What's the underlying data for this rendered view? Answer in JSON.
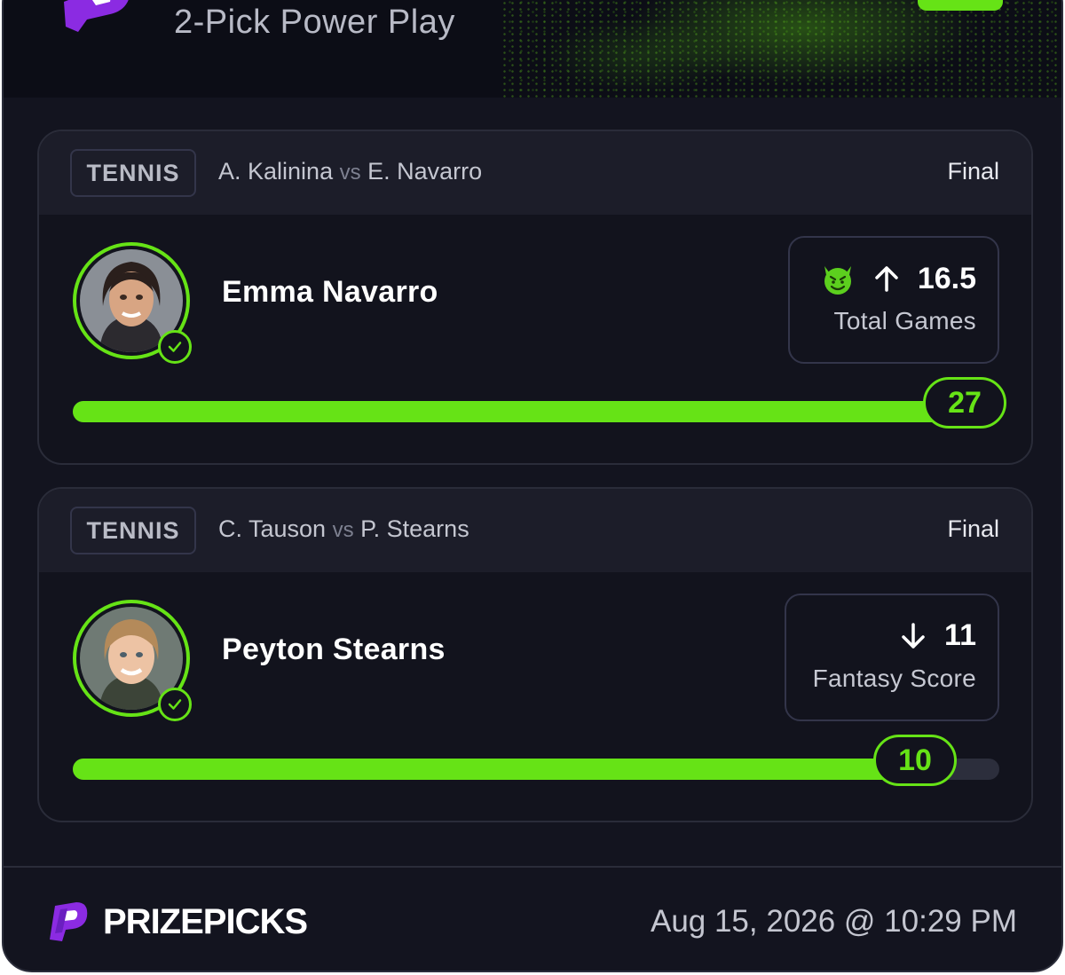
{
  "header": {
    "title": "2-Pick Power Play"
  },
  "picks": [
    {
      "sport": "TENNIS",
      "team_a": "A. Kalinina",
      "vs": "vs",
      "team_b": "E. Navarro",
      "status": "Final",
      "player": "Emma Navarro",
      "direction": "up",
      "line": "16.5",
      "stat": "Total Games",
      "result": "27",
      "progress_percent": 100,
      "icon": "demon-emoji-icon"
    },
    {
      "sport": "TENNIS",
      "team_a": "C. Tauson",
      "vs": "vs",
      "team_b": "P. Stearns",
      "status": "Final",
      "player": "Peyton Stearns",
      "direction": "down",
      "line": "11",
      "stat": "Fantasy Score",
      "result": "10",
      "progress_percent": 91
    }
  ],
  "footer": {
    "brand": "PRIZEPICKS",
    "timestamp": "Aug 15, 2026 @ 10:29 PM"
  },
  "colors": {
    "accent": "#66e316",
    "background": "#13141f",
    "logo": "#8b2be2"
  }
}
